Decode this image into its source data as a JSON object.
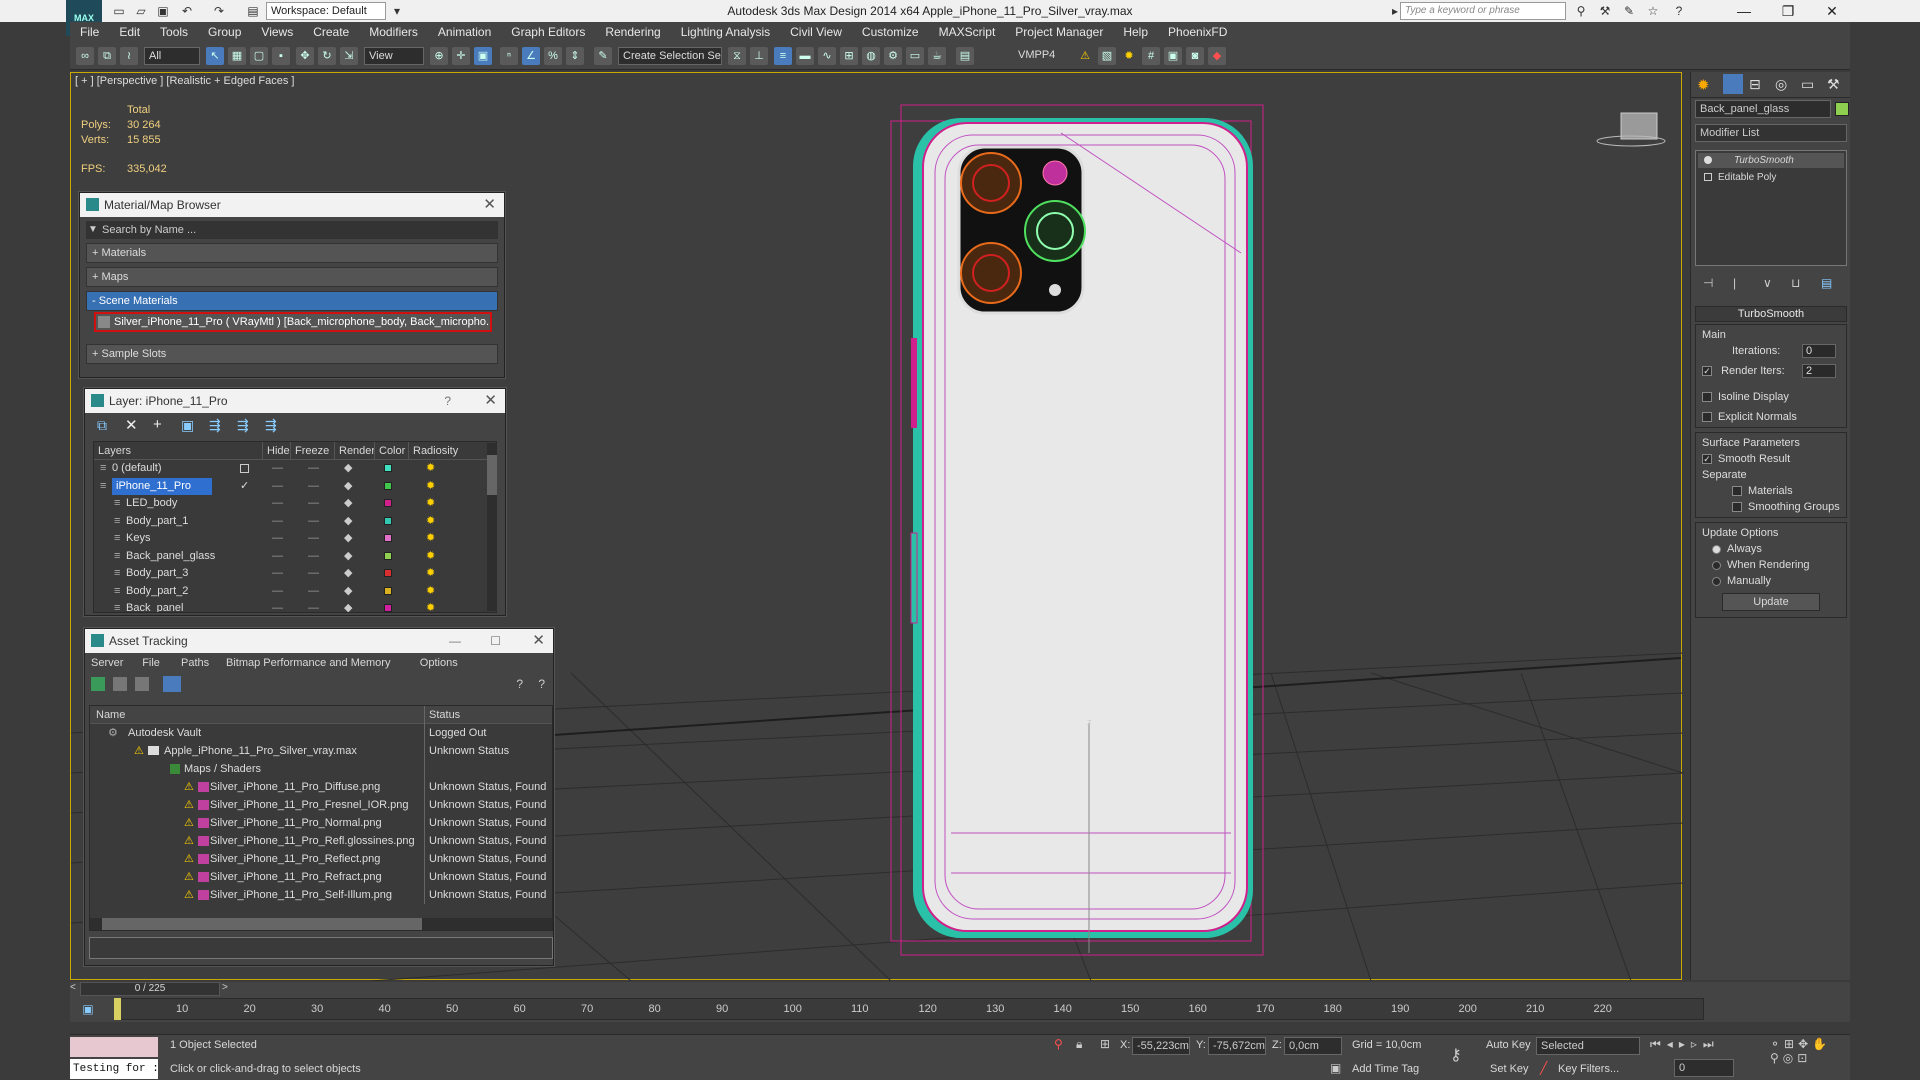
{
  "app": {
    "title": "Autodesk 3ds Max Design 2014 x64     Apple_iPhone_11_Pro_Silver_vray.max",
    "logo_text": "MAX",
    "workspace": "Workspace: Default",
    "search_placeholder": "Type a keyword or phrase"
  },
  "menu": [
    "File",
    "Edit",
    "Tools",
    "Group",
    "Views",
    "Create",
    "Modifiers",
    "Animation",
    "Graph Editors",
    "Rendering",
    "Lighting Analysis",
    "Civil View",
    "Customize",
    "MAXScript",
    "Project Manager",
    "Help",
    "PhoenixFD"
  ],
  "toolbar": {
    "filter_value": "All",
    "refcoord_value": "View",
    "selection_set_placeholder": "Create Selection Se",
    "vmpp_label": "VMPP4"
  },
  "viewport": {
    "label": "[ + ] [Perspective ] [Realistic + Edged Faces ]",
    "stats": {
      "total_label": "Total",
      "polys_label": "Polys:",
      "polys_value": "30 264",
      "verts_label": "Verts:",
      "verts_value": "15 855",
      "fps_label": "FPS:",
      "fps_value": "335,042"
    },
    "gizmo_label": "z"
  },
  "material_browser": {
    "title": "Material/Map Browser",
    "search_placeholder": "Search by Name ...",
    "sections": [
      "+ Materials",
      "+ Maps",
      "- Scene Materials",
      "+ Sample Slots"
    ],
    "scene_material": "Silver_iPhone_11_Pro ( VRayMtl ) [Back_microphone_body, Back_micropho..."
  },
  "layer_panel": {
    "title": "Layer: iPhone_11_Pro",
    "help": "?",
    "columns": [
      "Layers",
      "Hide",
      "Freeze",
      "Render",
      "Color",
      "Radiosity"
    ],
    "rows": [
      {
        "name": "0 (default)",
        "color": "#3fe0c0",
        "indent": 0
      },
      {
        "name": "iPhone_11_Pro",
        "color": "#3fc64c",
        "indent": 0,
        "selected": true
      },
      {
        "name": "LED_body",
        "color": "#d0208c",
        "indent": 1
      },
      {
        "name": "Body_part_1",
        "color": "#33c8b0",
        "indent": 1
      },
      {
        "name": "Keys",
        "color": "#e070c8",
        "indent": 1
      },
      {
        "name": "Back_panel_glass",
        "color": "#90d050",
        "indent": 1
      },
      {
        "name": "Body_part_3",
        "color": "#d83030",
        "indent": 1
      },
      {
        "name": "Body_part_2",
        "color": "#d8b020",
        "indent": 1
      },
      {
        "name": "Back_panel",
        "color": "#d020a0",
        "indent": 1
      }
    ]
  },
  "asset_tracking": {
    "title": "Asset Tracking",
    "menu": [
      "Server",
      "File",
      "Paths",
      "Bitmap Performance and Memory",
      "Options"
    ],
    "columns": [
      "Name",
      "Status"
    ],
    "rows": [
      {
        "name": "Autodesk Vault",
        "status": "Logged Out",
        "indent": 0
      },
      {
        "name": "Apple_iPhone_11_Pro_Silver_vray.max",
        "status": "Unknown Status",
        "indent": 1
      },
      {
        "name": "Maps / Shaders",
        "status": "",
        "indent": 2
      },
      {
        "name": "Silver_iPhone_11_Pro_Diffuse.png",
        "status": "Unknown Status, Found",
        "indent": 3
      },
      {
        "name": "Silver_iPhone_11_Pro_Fresnel_IOR.png",
        "status": "Unknown Status, Found",
        "indent": 3
      },
      {
        "name": "Silver_iPhone_11_Pro_Normal.png",
        "status": "Unknown Status, Found",
        "indent": 3
      },
      {
        "name": "Silver_iPhone_11_Pro_Refl.glossines.png",
        "status": "Unknown Status, Found",
        "indent": 3
      },
      {
        "name": "Silver_iPhone_11_Pro_Reflect.png",
        "status": "Unknown Status, Found",
        "indent": 3
      },
      {
        "name": "Silver_iPhone_11_Pro_Refract.png",
        "status": "Unknown Status, Found",
        "indent": 3
      },
      {
        "name": "Silver_iPhone_11_Pro_Self-Illum.png",
        "status": "Unknown Status, Found",
        "indent": 3
      }
    ]
  },
  "command_panel": {
    "object_name": "Back_panel_glass",
    "object_color": "#90d050",
    "modifier_list": "Modifier List",
    "stack": [
      "TurboSmooth",
      "Editable Poly"
    ],
    "rollout_title": "TurboSmooth",
    "main_label": "Main",
    "iterations_label": "Iterations:",
    "iterations_value": "0",
    "render_iters_label": "Render Iters:",
    "render_iters_value": "2",
    "isoline": "Isoline Display",
    "explicit_normals": "Explicit Normals",
    "surface_params": "Surface Parameters",
    "smooth_result": "Smooth Result",
    "separate": "Separate",
    "materials": "Materials",
    "smoothing_groups": "Smoothing Groups",
    "update_options": "Update Options",
    "always": "Always",
    "when_rendering": "When Rendering",
    "manually": "Manually",
    "update_button": "Update"
  },
  "timeline": {
    "frame_counter": "0 / 225",
    "ticks": [
      "10",
      "20",
      "30",
      "40",
      "50",
      "60",
      "70",
      "80",
      "90",
      "100",
      "110",
      "120",
      "130",
      "140",
      "150",
      "160",
      "170",
      "180",
      "190",
      "200",
      "210",
      "220"
    ]
  },
  "status_bar": {
    "maxscript_text": "Testing for :",
    "selected_text": "1 Object Selected",
    "prompt_text": "Click or click-and-drag to select objects",
    "x_label": "X:",
    "x_value": "-55,223cm",
    "y_label": "Y:",
    "y_value": "-75,672cm",
    "z_label": "Z:",
    "z_value": "0,0cm",
    "grid_text": "Grid = 10,0cm",
    "add_time_tag": "Add Time Tag",
    "auto_key": "Auto Key",
    "set_key": "Set Key",
    "selected_dropdown": "Selected",
    "key_filters": "Key Filters...",
    "frame_value": "0"
  }
}
